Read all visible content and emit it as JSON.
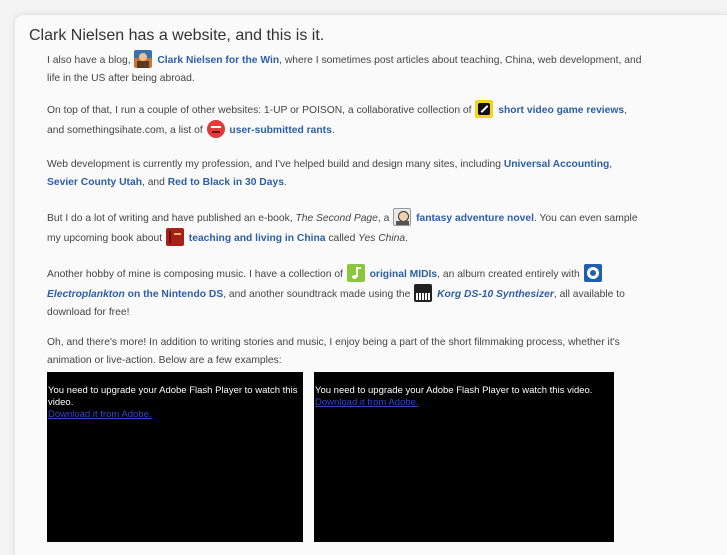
{
  "page": {
    "title": "Clark Nielsen has a website, and this is it."
  },
  "para1": {
    "t1": "I also have a blog, ",
    "link_blog": "Clark Nielsen for the Win",
    "t2": ", where I sometimes post articles about teaching, China, web development, and life in the US after being abroad."
  },
  "para2": {
    "t1": "On top of that, I run a couple of other websites: 1-UP or POISON, a collaborative collection of ",
    "link_reviews": "short video game reviews",
    "t2": ", and somethingsihate.com, a list of ",
    "link_rants": "user-submitted rants",
    "t3": "."
  },
  "para3": {
    "t1": "Web development is currently my profession, and I've helped build and design many sites, including ",
    "link1": "Universal Accounting",
    "t2": ", ",
    "link2": "Sevier County Utah",
    "t3": ", and ",
    "link3": "Red to Black in 30 Days",
    "t4": "."
  },
  "para4": {
    "t1": "But I do a lot of writing and have published an e-book, ",
    "book": "The Second Page",
    "t2": ", a ",
    "link_novel": "fantasy adventure novel",
    "t3": ". You can even sample my upcoming book about ",
    "link_china": "teaching and living in China",
    "t4": " called ",
    "book2": "Yes China",
    "t5": "."
  },
  "para5": {
    "t1": "Another hobby of mine is composing music. I have a collection of ",
    "link_midis": "original MIDIs",
    "t2": ", an album created entirely with ",
    "link_electro_em": "Electroplankton",
    "link_electro_rest": " on the Nintendo DS",
    "t3": ", and another soundtrack made using the ",
    "link_korg": "Korg DS-10 Synthesizer",
    "t4": ", all available to download for free!"
  },
  "para6": {
    "t1": "Oh, and there's more! In addition to writing stories and music, I enjoy being a part of the short filmmaking process, whether it's animation or live-action. Below are a few examples:"
  },
  "videos": [
    {
      "message": "You need to upgrade your Adobe Flash Player to watch this video.",
      "link": "Download it from Adobe."
    },
    {
      "message": "You need to upgrade your Adobe Flash Player to watch this video.",
      "link": "Download it from Adobe."
    }
  ],
  "icons": {
    "blog": "blog-avatar-icon",
    "reviews": "pencil-icon",
    "rants": "angry-face-icon",
    "novel": "portrait-icon",
    "china": "book-icon",
    "midis": "music-note-icon",
    "electro": "electroplankton-icon",
    "korg": "keyboard-icon"
  }
}
